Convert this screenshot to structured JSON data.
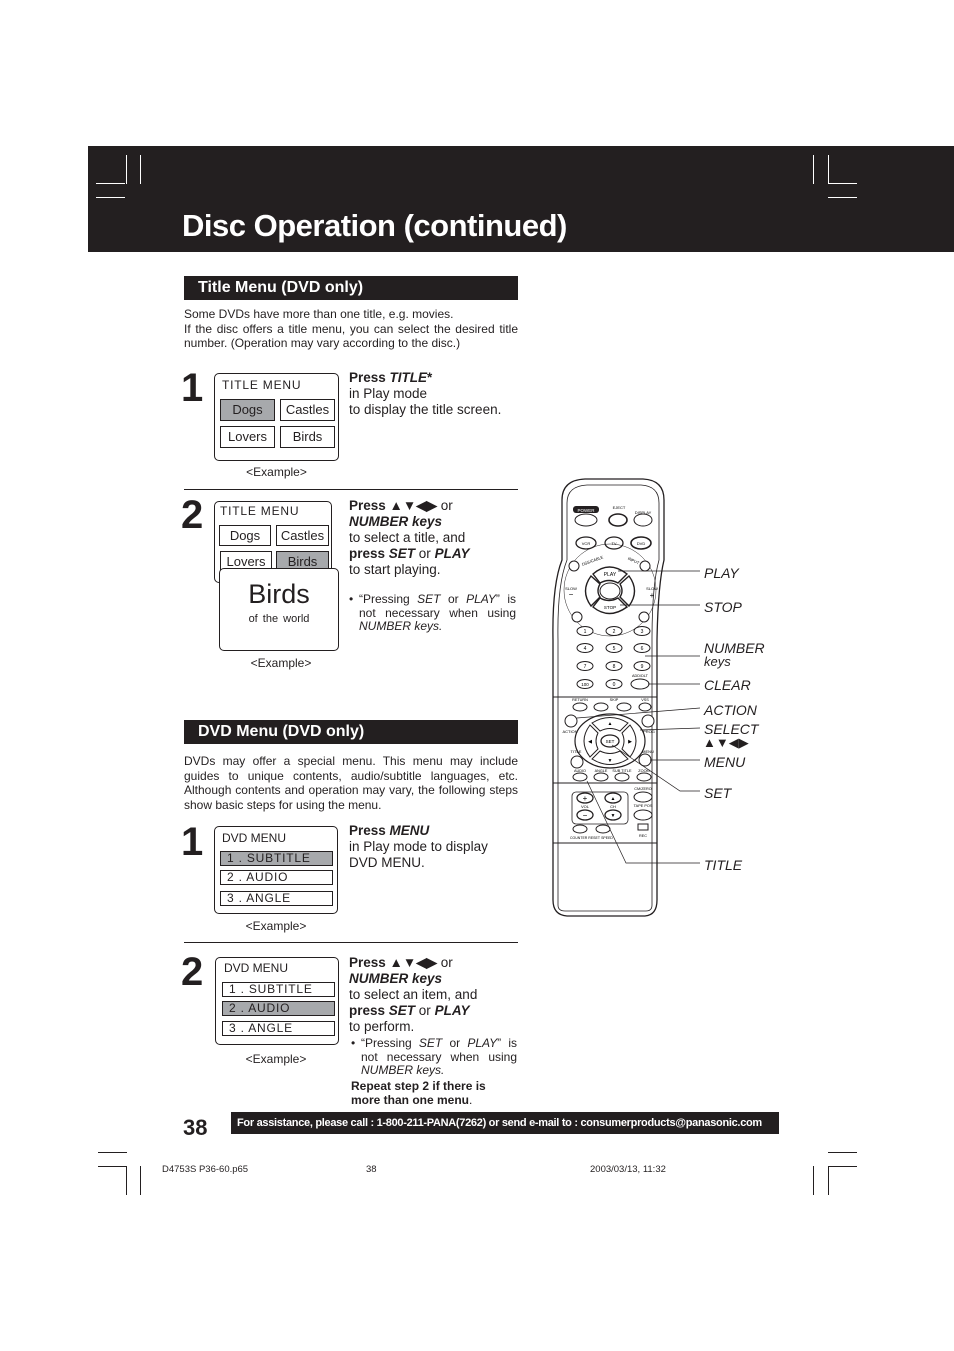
{
  "header": {
    "title": "Disc Operation (continued)"
  },
  "title_menu_section": {
    "heading": "Title Menu (DVD only)",
    "intro": [
      "Some DVDs have more than one title, e.g. movies.",
      "If the disc offers a title menu, you can select the desired title number. (Operation may vary according to the disc.)"
    ],
    "step1": {
      "number": "1",
      "screen_title": "TITLE  MENU",
      "tiles": [
        {
          "label": "Dogs",
          "selected": true
        },
        {
          "label": "Castles",
          "selected": false
        },
        {
          "label": "Lovers",
          "selected": false
        },
        {
          "label": "Birds",
          "selected": false
        }
      ],
      "example": "<Example>",
      "instruction": {
        "press": "Press ",
        "key": "TITLE",
        "star": "*",
        "line2": "in Play mode",
        "line3": "to display the title screen."
      }
    },
    "step2": {
      "number": "2",
      "screen_title": "TITLE  MENU",
      "tiles": [
        {
          "label": "Dogs",
          "selected": false
        },
        {
          "label": "Castles",
          "selected": false
        },
        {
          "label": "Lovers",
          "selected": false
        },
        {
          "label": "Birds",
          "selected": true
        }
      ],
      "popup_title": "Birds",
      "popup_subtitle": "of  the  world",
      "example": "<Example>",
      "instruction": {
        "press": "Press ",
        "arrows": "▲▼◀▶",
        "or": " or",
        "number_keys": "NUMBER keys",
        "line3": "to select a title, and",
        "press2": "press ",
        "set": "SET",
        "or2": " or ",
        "play": "PLAY",
        "line5": "to start playing."
      },
      "note": {
        "bullet": "•",
        "q1": "“Pressing ",
        "set": "SET",
        "or": " or ",
        "play": "PLAY",
        "q2": "” is not necessary when using ",
        "keys": "NUMBER keys."
      }
    }
  },
  "dvd_menu_section": {
    "heading": "DVD Menu (DVD only)",
    "intro": "DVDs may offer a special menu. This menu may include guides to unique contents, audio/subtitle languages, etc. Although contents and operation may vary, the following steps show basic steps for using the menu.",
    "step1": {
      "number": "1",
      "screen_title": "DVD MENU",
      "items": [
        {
          "label": "1 . SUBTITLE",
          "selected": true
        },
        {
          "label": "2 . AUDIO",
          "selected": false
        },
        {
          "label": "3 . ANGLE",
          "selected": false
        }
      ],
      "example": "<Example>",
      "instruction": {
        "press": "Press ",
        "key": "MENU",
        "line2": "in Play mode to display",
        "line3": "DVD MENU."
      }
    },
    "step2": {
      "number": "2",
      "screen_title": "DVD MENU",
      "items": [
        {
          "label": "1 . SUBTITLE",
          "selected": false
        },
        {
          "label": "2 . AUDIO",
          "selected": true
        },
        {
          "label": "3 . ANGLE",
          "selected": false
        }
      ],
      "example": "<Example>",
      "instruction": {
        "press": "Press ",
        "arrows": "▲▼◀▶",
        "or": " or",
        "number_keys": "NUMBER keys",
        "line3": "to select an item, and",
        "press2": "press ",
        "set": "SET",
        "or2": " or ",
        "play": "PLAY",
        "line5": "to perform."
      },
      "note": {
        "bullet": "•",
        "q1": "“Pressing ",
        "set": "SET",
        "or": " or ",
        "play": "PLAY",
        "q2": "” is not necessary when using ",
        "keys": "NUMBER keys."
      },
      "repeat": {
        "text": "Repeat step 2 if there is more than one menu",
        "period": "."
      }
    }
  },
  "remote": {
    "buttons": {
      "power": "POWER",
      "eject": "EJECT",
      "open_close": "OPEN/CLOSE",
      "display": "DISPLAY",
      "vcr": "VCR",
      "tv": "TV",
      "dvd": "DVD",
      "dss_cable": "DSS/CABLE",
      "input": "INPUT",
      "play": "PLAY",
      "stop": "STOP",
      "rew": "REW",
      "ff": "FF",
      "slow_minus": "SLOW",
      "slow_plus": "SLOW",
      "vcr_tv": "VCR/TV",
      "pause": "PAUSE",
      "still": "STILL",
      "digits": [
        "1",
        "2",
        "3",
        "4",
        "5",
        "6",
        "7",
        "8",
        "9",
        "100",
        "0"
      ],
      "add_dlt": "ADD/DLT",
      "clear": "CLEAR",
      "return": "RETURN",
      "skip": "SKIP",
      "vss": "VSS",
      "action": "ACTION",
      "prog": "PROG",
      "set": "SET",
      "title": "TITLE",
      "menu": "MENU",
      "audio": "AUDIO",
      "angle": "ANGLE",
      "sub_title": "SUB TITLE",
      "zoom": "ZOOM",
      "vol": "VOL",
      "ch": "CH",
      "cm_zero": "CM/ZERO",
      "tape_pos": "TAPE POS",
      "counter_reset": "COUNTER RESET",
      "speed": "SPEED",
      "rec": "REC"
    },
    "callouts": {
      "play": "PLAY",
      "stop": "STOP",
      "number": "NUMBER",
      "keys": "keys",
      "clear": "CLEAR",
      "action": "ACTION",
      "select": "SELECT",
      "select_arrows": "▲▼◀▶",
      "menu": "MENU",
      "set": "SET",
      "title": "TITLE"
    }
  },
  "footer": {
    "page_number": "38",
    "assistance": "For assistance, please call : 1-800-211-PANA(7262) or send e-mail to : consumerproducts@panasonic.com",
    "file": "D4753S P36-60.p65",
    "sheet": "38",
    "timestamp": "2003/03/13, 11:32"
  }
}
